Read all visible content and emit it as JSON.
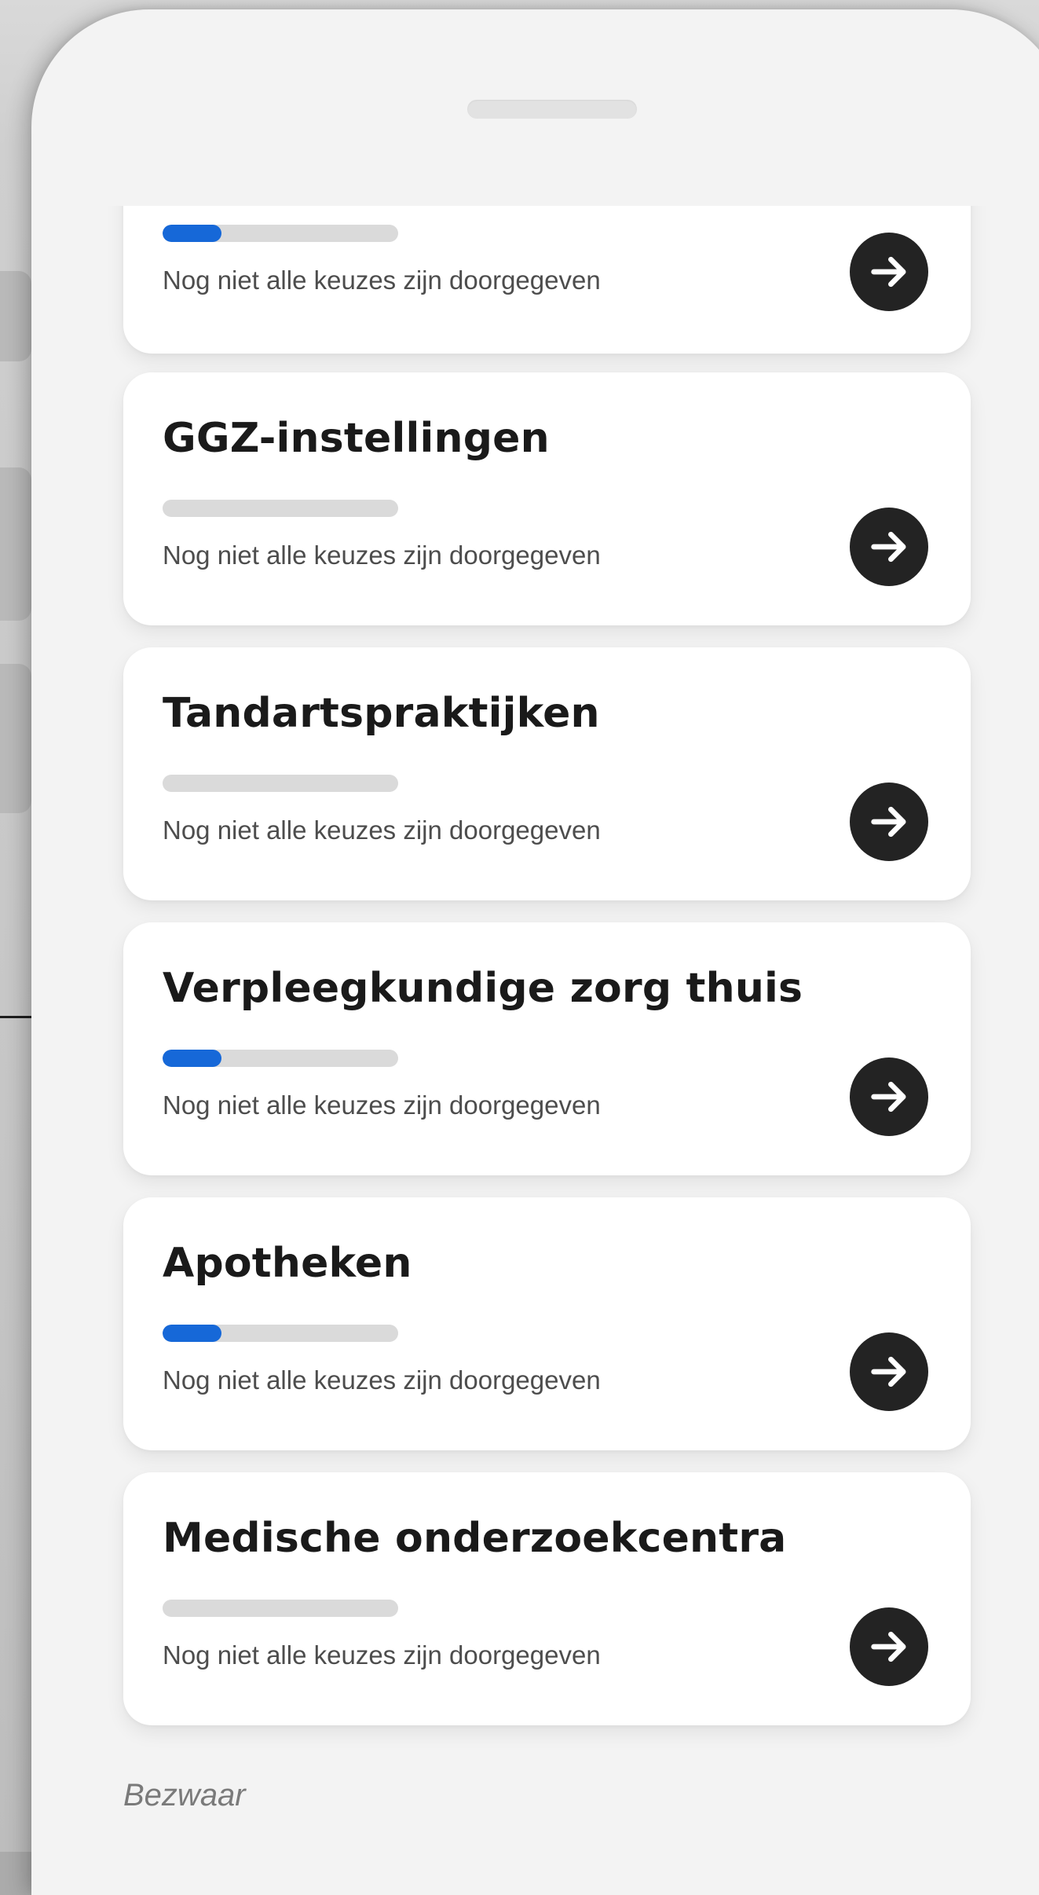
{
  "cards": [
    {
      "title": "",
      "progress": 0.25,
      "status": "Nog niet alle keuzes zijn doorgegeven",
      "icon": "arrow-right-icon"
    },
    {
      "title": "GGZ-instellingen",
      "progress": 0,
      "status": "Nog niet alle keuzes zijn doorgegeven",
      "icon": "arrow-right-icon"
    },
    {
      "title": "Tandartspraktijken",
      "progress": 0,
      "status": "Nog niet alle keuzes zijn doorgegeven",
      "icon": "arrow-right-icon"
    },
    {
      "title": "Verpleegkundige zorg thuis",
      "progress": 0.25,
      "status": "Nog niet alle keuzes zijn doorgegeven",
      "icon": "arrow-right-icon"
    },
    {
      "title": "Apotheken",
      "progress": 0.25,
      "status": "Nog niet alle keuzes zijn doorgegeven",
      "icon": "arrow-right-icon"
    },
    {
      "title": "Medische onderzoekcentra",
      "progress": 0,
      "status": "Nog niet alle keuzes zijn doorgegeven",
      "icon": "arrow-right-icon"
    }
  ],
  "footer": {
    "appeal_label": "Bezwaar"
  },
  "colors": {
    "progress_fill": "#1668d8",
    "progress_track": "#dadada",
    "button": "#232323",
    "page_background": "#f3f3f3",
    "card_background": "#ffffff"
  }
}
